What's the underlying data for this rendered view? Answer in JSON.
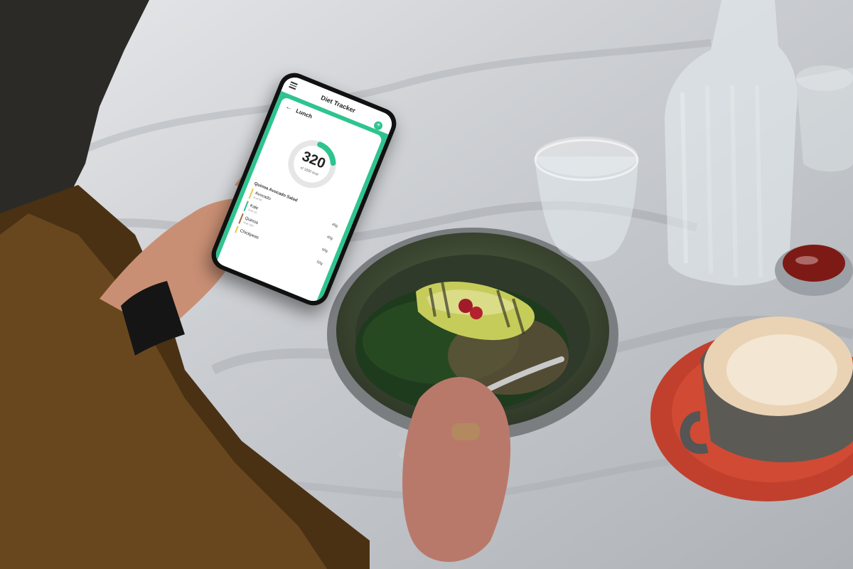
{
  "scene": {
    "description": "Person holding a smartphone with a diet tracker app above a bowl of salad on a marble table, with glass of water, bottle, coffee cup and sauce dish."
  },
  "app": {
    "title": "Diet Tracker",
    "header": {
      "back_label": "Lunch",
      "add_icon": "plus-icon"
    },
    "calories": {
      "value": "320",
      "subtitle": "of 1800 kcal",
      "progress_fraction": 0.18
    },
    "meal": {
      "name": "Quinoa Avocado Salad"
    },
    "items": [
      {
        "name": "Avocado",
        "kcal": "80",
        "qty": "40g"
      },
      {
        "name": "Kale",
        "kcal": "25",
        "qty": "40g"
      },
      {
        "name": "Quinoa",
        "kcal": "100",
        "qty": "50g"
      },
      {
        "name": "Chickpeas",
        "kcal": "",
        "qty": "50g"
      }
    ],
    "colors": {
      "accent": "#2fc48f"
    }
  }
}
